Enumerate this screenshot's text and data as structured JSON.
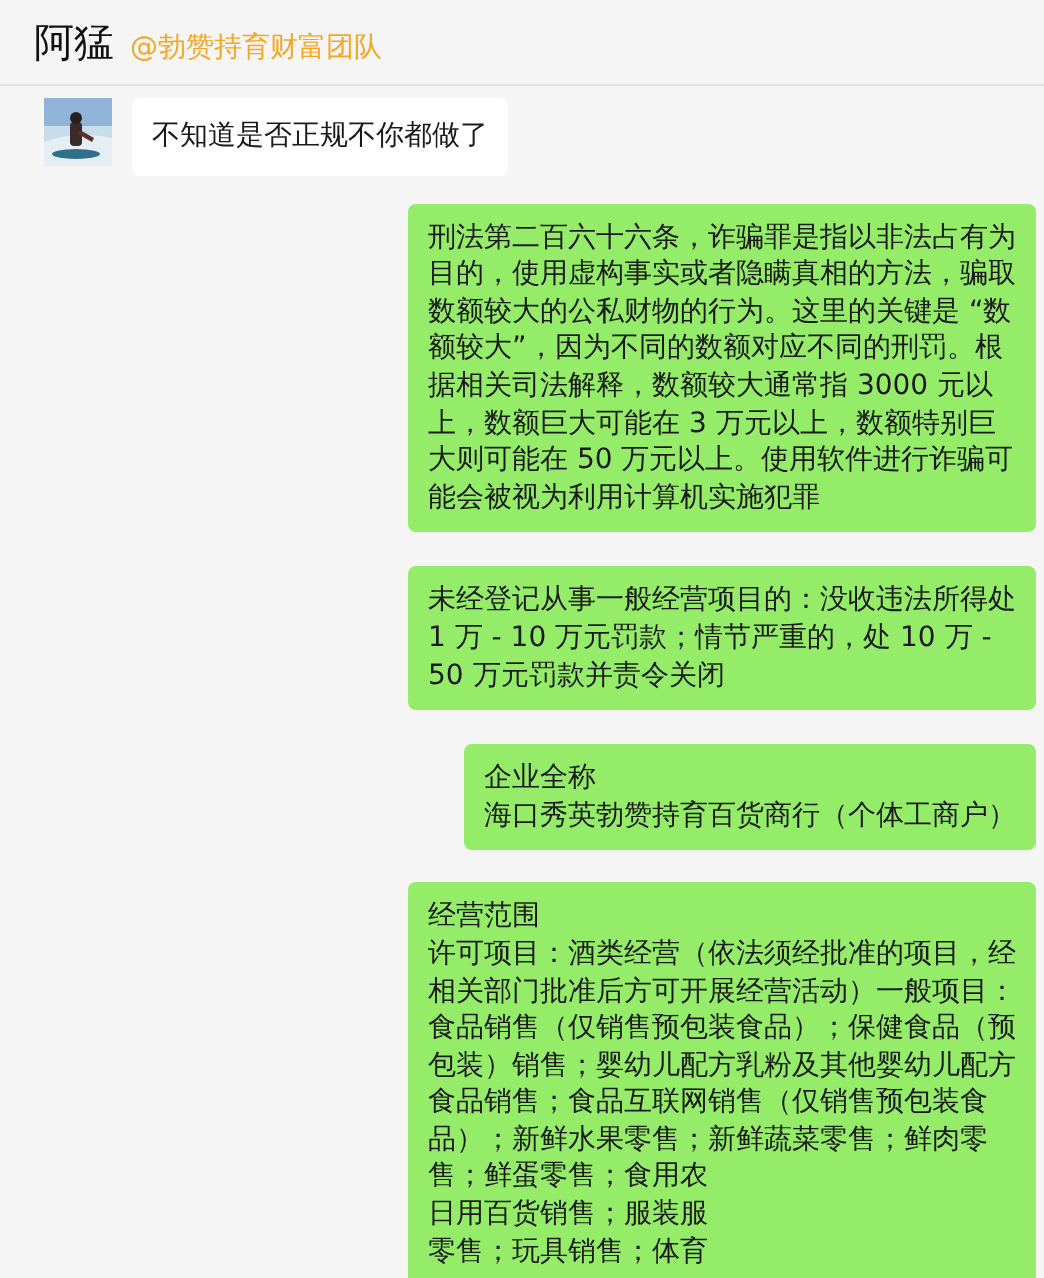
{
  "header": {
    "name": "阿猛",
    "tag": "@勃赞持育财富团队"
  },
  "messages": [
    {
      "outgoing": false,
      "kind": "text",
      "paragraphs": [
        "不知道是否正规不你都做了"
      ]
    },
    {
      "outgoing": true,
      "kind": "text",
      "paragraphs": [
        "刑法第二百六十六条，诈骗罪是指以非法占有为目的，使用虚构事实或者隐瞒真相的方法，骗取数额较大的公私财物的行为。这里的关键是 “数额较大”，因为不同的数额对应不同的刑罚。根据相关司法解释，数额较大通常指 3000 元以上，数额巨大可能在 3 万元以上，数额特别巨大则可能在 50 万元以上。使用软件进行诈骗可能会被视为利用计算机实施犯罪"
      ]
    },
    {
      "outgoing": true,
      "kind": "text",
      "paragraphs": [
        "未经登记从事一般经营项目的：没收违法所得处 1 万 - 10 万元罚款；情节严重的，处 10 万 - 50 万元罚款并责令关闭"
      ]
    },
    {
      "outgoing": true,
      "kind": "text",
      "paragraphs": [
        "企业全称",
        "海口秀英勃赞持育百货商行（个体工商户）"
      ]
    },
    {
      "outgoing": true,
      "kind": "lines",
      "paragraphs": [
        "经营范围",
        "许可项目：酒类经营（依法须经批准的项目，经",
        "相关部门批准后方可开展经营活动）一般项目：",
        "食品销售（仅销售预包装食品）；保健食品（预",
        "包装）销售；婴幼儿配方乳粉及其他婴幼儿配方",
        "食品销售；食品互联网销售（仅销售预包装食",
        "品）；新鲜水果零售；新鲜蔬菜零售；鲜肉零",
        "售；鲜蛋零售；食用农",
        "日用百货销售；服装服",
        "零售；玩具销售；体育"
      ]
    }
  ]
}
